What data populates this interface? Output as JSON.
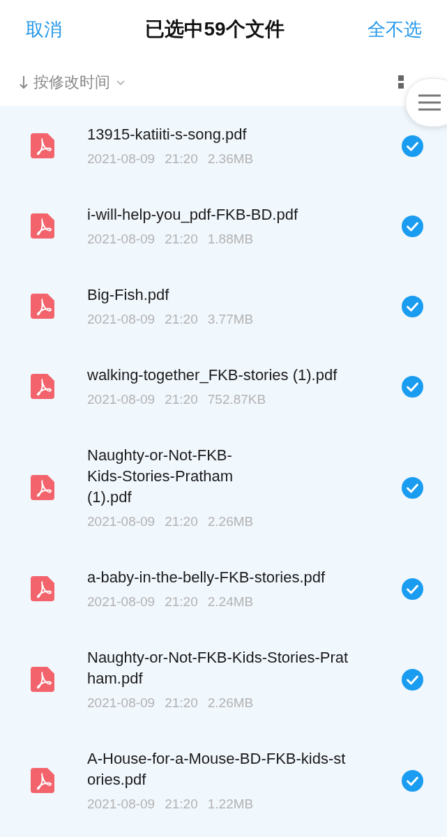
{
  "header": {
    "cancel": "取消",
    "title": "已选中59个文件",
    "deselect_all": "全不选"
  },
  "sort": {
    "label": "按修改时间"
  },
  "files": [
    {
      "name": "13915-katiiti-s-song.pdf",
      "date": "2021-08-09",
      "time": "21:20",
      "size": "2.36MB",
      "selected": true
    },
    {
      "name": "i-will-help-you_pdf-FKB-BD.pdf",
      "date": "2021-08-09",
      "time": "21:20",
      "size": "1.88MB",
      "selected": true
    },
    {
      "name": "Big-Fish.pdf",
      "date": "2021-08-09",
      "time": "21:20",
      "size": "3.77MB",
      "selected": true
    },
    {
      "name": "walking-together_FKB-stories (1).pdf",
      "date": "2021-08-09",
      "time": "21:20",
      "size": "752.87KB",
      "selected": true
    },
    {
      "name": "Naughty-or-Not-FKB-\nKids-Stories-Pratham\n(1).pdf",
      "date": "2021-08-09",
      "time": "21:20",
      "size": "2.26MB",
      "selected": true
    },
    {
      "name": "a-baby-in-the-belly-FKB-stories.pdf",
      "date": "2021-08-09",
      "time": "21:20",
      "size": "2.24MB",
      "selected": true
    },
    {
      "name": "Naughty-or-Not-FKB-Kids-Stories-Prat\nham.pdf",
      "date": "2021-08-09",
      "time": "21:20",
      "size": "2.26MB",
      "selected": true
    },
    {
      "name": "A-House-for-a-Mouse-BD-FKB-kids-st\nories.pdf",
      "date": "2021-08-09",
      "time": "21:20",
      "size": "1.22MB",
      "selected": true
    }
  ]
}
